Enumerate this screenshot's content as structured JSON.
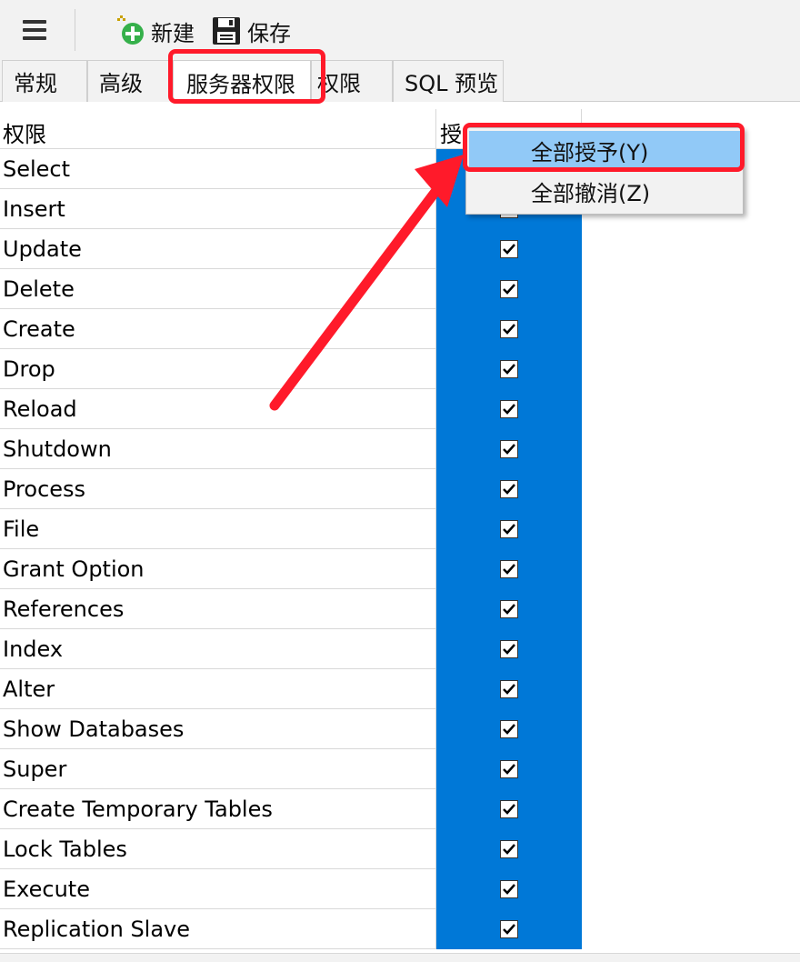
{
  "toolbar": {
    "menu_icon": "hamburger-menu-icon",
    "new_label": "新建",
    "new_icon": "add-new-icon",
    "save_label": "保存",
    "save_icon": "floppy-disk-icon"
  },
  "tabs": [
    {
      "label": "常规",
      "active": false
    },
    {
      "label": "高级",
      "active": false
    },
    {
      "label": "服务器权限",
      "active": true
    },
    {
      "label": "权限",
      "active": false
    },
    {
      "label": "SQL 预览",
      "active": false
    }
  ],
  "grid": {
    "header_name": "权限",
    "header_grant": "授",
    "rows": [
      {
        "name": "Select",
        "granted": true
      },
      {
        "name": "Insert",
        "granted": true
      },
      {
        "name": "Update",
        "granted": true
      },
      {
        "name": "Delete",
        "granted": true
      },
      {
        "name": "Create",
        "granted": true
      },
      {
        "name": "Drop",
        "granted": true
      },
      {
        "name": "Reload",
        "granted": true
      },
      {
        "name": "Shutdown",
        "granted": true
      },
      {
        "name": "Process",
        "granted": true
      },
      {
        "name": "File",
        "granted": true
      },
      {
        "name": "Grant Option",
        "granted": true
      },
      {
        "name": "References",
        "granted": true
      },
      {
        "name": "Index",
        "granted": true
      },
      {
        "name": "Alter",
        "granted": true
      },
      {
        "name": "Show Databases",
        "granted": true
      },
      {
        "name": "Super",
        "granted": true
      },
      {
        "name": "Create Temporary Tables",
        "granted": true
      },
      {
        "name": "Lock Tables",
        "granted": true
      },
      {
        "name": "Execute",
        "granted": true
      },
      {
        "name": "Replication Slave",
        "granted": true
      }
    ]
  },
  "context_menu": {
    "grant_all": "全部授予(Y)",
    "revoke_all": "全部撤消(Z)"
  },
  "colors": {
    "selection_blue": "#0078d7",
    "menu_highlight": "#91c9f7",
    "annotation_red": "#ff1a2a"
  }
}
